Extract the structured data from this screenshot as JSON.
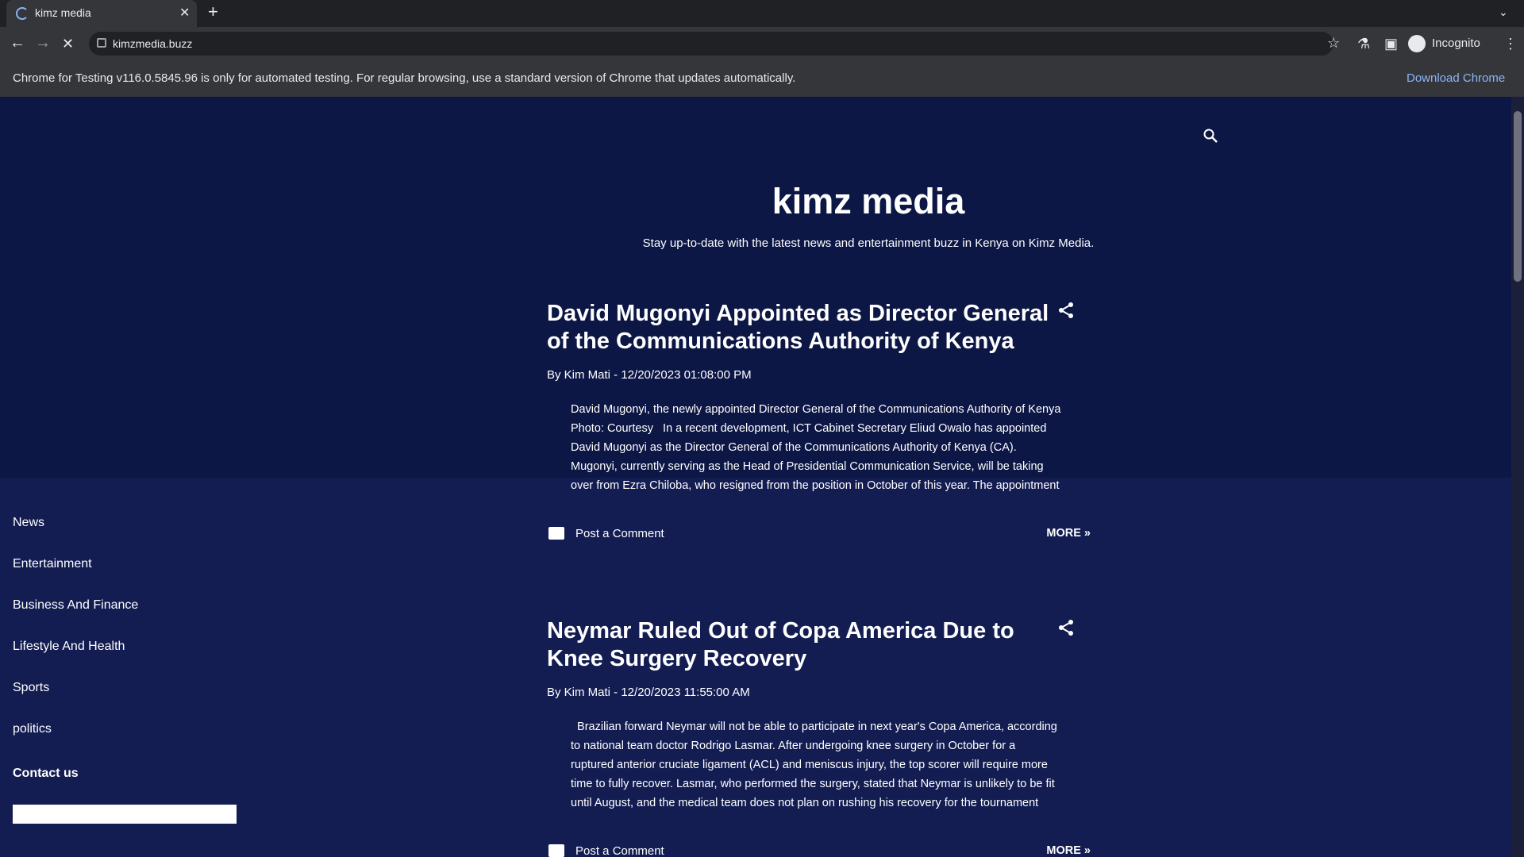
{
  "browser": {
    "tab_title": "kimz media",
    "url": "kimzmedia.buzz",
    "profile_label": "Incognito",
    "infobar_text": "Chrome for Testing v116.0.5845.96 is only for automated testing. For regular browsing, use a standard version of Chrome that updates automatically.",
    "infobar_action": "Download Chrome"
  },
  "site": {
    "title": "kimz media",
    "tagline": "Stay up-to-date with the latest news and entertainment buzz in Kenya on Kimz Media."
  },
  "sidebar": {
    "items": [
      {
        "label": "News"
      },
      {
        "label": "Entertainment"
      },
      {
        "label": "Business And Finance"
      },
      {
        "label": "Lifestyle And Health"
      },
      {
        "label": "Sports"
      },
      {
        "label": "politics"
      }
    ],
    "contact_label": "Contact us"
  },
  "posts": [
    {
      "title_line1": "David Mugonyi Appointed as Director General",
      "title_line2": "of the Communications Authority of Kenya",
      "byline": "By Kim Mati - 12/20/2023 01:08:00 PM",
      "snippet": [
        "David Mugonyi, the newly appointed Director General of the Communications Authority of Kenya",
        "Photo: Courtesy   In a recent development, ICT Cabinet Secretary Eliud Owalo has appointed",
        "David Mugonyi as the Director General of the Communications Authority of Kenya (CA).",
        "Mugonyi, currently serving as the Head of Presidential Communication Service, will be taking",
        "over from Ezra Chiloba, who resigned from the position in October of this year. The appointment"
      ],
      "comment_label": "Post a Comment",
      "more_label": "MORE »"
    },
    {
      "title_line1": "Neymar Ruled Out of Copa America Due to",
      "title_line2": "Knee Surgery Recovery",
      "byline": "By Kim Mati - 12/20/2023 11:55:00 AM",
      "snippet": [
        "  Brazilian forward Neymar will not be able to participate in next year's Copa America, according",
        "to national team doctor Rodrigo Lasmar. After undergoing knee surgery in October for a",
        "ruptured anterior cruciate ligament (ACL) and meniscus injury, the top scorer will require more",
        "time to fully recover. Lasmar, who performed the surgery, stated that Neymar is unlikely to be fit",
        "until August, and the medical team does not plan on rushing his recovery for the tournament"
      ],
      "comment_label": "Post a Comment",
      "more_label": "MORE »"
    }
  ]
}
